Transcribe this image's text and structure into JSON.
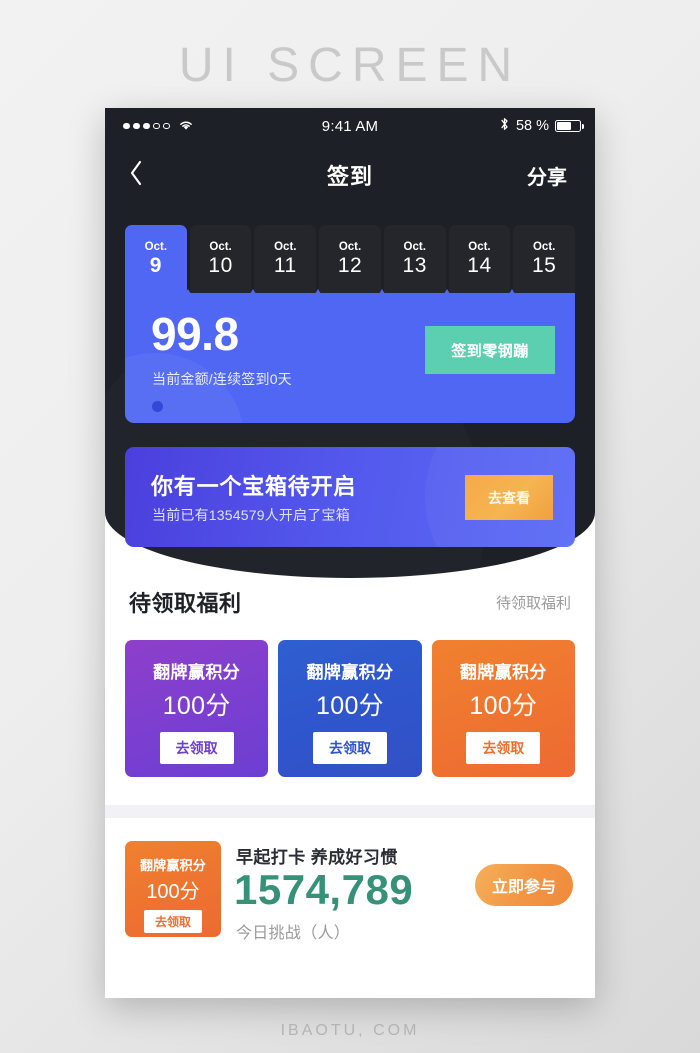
{
  "page": {
    "title": "UI SCREEN",
    "footer": "IBAOTU, COM"
  },
  "status_bar": {
    "time": "9:41 AM",
    "battery_percent": "58 %",
    "signal_dots_filled": 3,
    "signal_dots_total": 5,
    "wifi_icon": "wifi-icon",
    "bluetooth_icon": "bluetooth-icon",
    "battery_icon": "battery-icon"
  },
  "nav": {
    "back_icon": "chevron-left-icon",
    "title": "签到",
    "action": "分享"
  },
  "date_tabs": [
    {
      "month": "Oct.",
      "day": "9",
      "active": true
    },
    {
      "month": "Oct.",
      "day": "10",
      "active": false
    },
    {
      "month": "Oct.",
      "day": "11",
      "active": false
    },
    {
      "month": "Oct.",
      "day": "12",
      "active": false
    },
    {
      "month": "Oct.",
      "day": "13",
      "active": false
    },
    {
      "month": "Oct.",
      "day": "14",
      "active": false
    },
    {
      "month": "Oct.",
      "day": "15",
      "active": false
    }
  ],
  "balance_card": {
    "amount": "99.8",
    "subtitle": "当前金额/连续签到0天",
    "button_label": "签到零钢蹦",
    "button_color": "#5ccfb0",
    "background_color": "#5067f3",
    "pager_dot": "pagination-dot"
  },
  "treasure_banner": {
    "title": "你有一个宝箱待开启",
    "subtitle": "当前已有1354579人开启了宝箱",
    "button_label": "去查看",
    "button_color": "#f5b551"
  },
  "welfare": {
    "heading": "待领取福利",
    "more_label": "待领取福利",
    "cards": [
      {
        "title": "翻牌赢积分",
        "value": "100分",
        "button_label": "去领取",
        "color": "#7c3fd0"
      },
      {
        "title": "翻牌赢积分",
        "value": "100分",
        "button_label": "去领取",
        "color": "#2f55cc"
      },
      {
        "title": "翻牌赢积分",
        "value": "100分",
        "button_label": "去领取",
        "color": "#ee7330"
      }
    ]
  },
  "challenge": {
    "badge": {
      "title": "翻牌赢积分",
      "value": "100分",
      "button_label": "去领取",
      "color": "#ee7330"
    },
    "title": "早起打卡 养成好习惯",
    "number": "1574,789",
    "caption": "今日挑战（人）",
    "cta_label": "立即参与",
    "number_color": "#379179"
  }
}
